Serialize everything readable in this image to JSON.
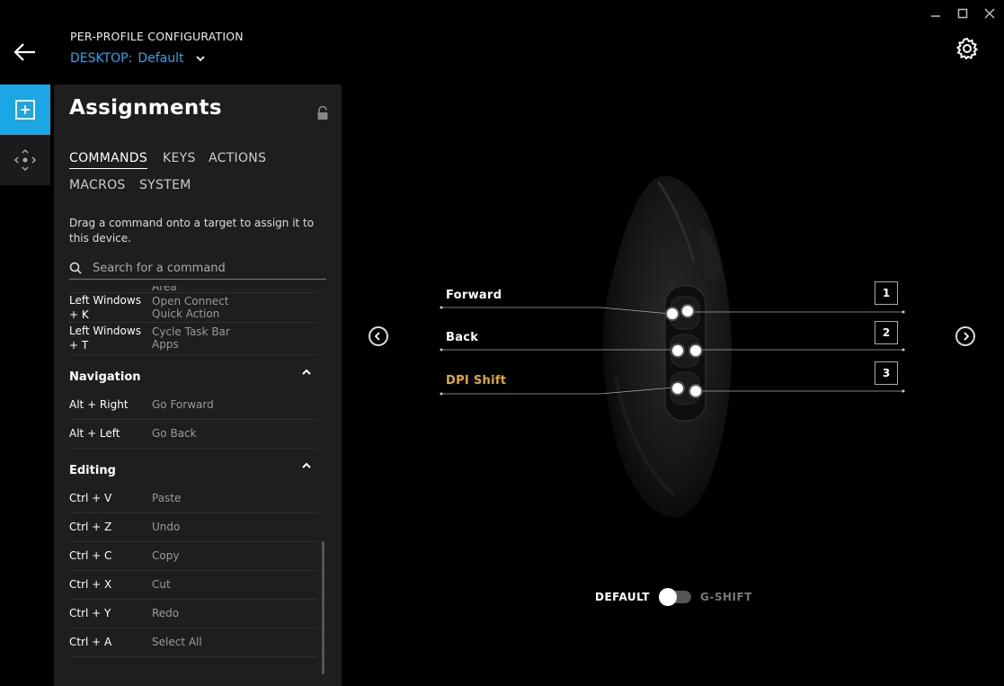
{
  "window": {
    "controls": [
      "minimize",
      "maximize",
      "close"
    ]
  },
  "header": {
    "title": "PER-PROFILE CONFIGURATION",
    "profile_label": "DESKTOP:",
    "profile_name": "Default"
  },
  "panel": {
    "title": "Assignments",
    "tabs": [
      {
        "label": "COMMANDS",
        "active": true
      },
      {
        "label": "KEYS"
      },
      {
        "label": "ACTIONS"
      },
      {
        "label": "MACROS"
      },
      {
        "label": "SYSTEM"
      }
    ],
    "help_text": "Drag a command onto a target to assign it to this device.",
    "search_placeholder": "Search for a command",
    "partial_top": "Area",
    "rows_top": [
      {
        "keys": "Left Windows + K",
        "command": "Open Connect Quick Action"
      },
      {
        "keys": "Left Windows + T",
        "command": "Cycle Task Bar Apps"
      }
    ],
    "sections": [
      {
        "title": "Navigation",
        "rows": [
          {
            "keys": "Alt + Right",
            "command": "Go Forward"
          },
          {
            "keys": "Alt + Left",
            "command": "Go Back"
          }
        ]
      },
      {
        "title": "Editing",
        "rows": [
          {
            "keys": "Ctrl + V",
            "command": "Paste"
          },
          {
            "keys": "Ctrl + Z",
            "command": "Undo"
          },
          {
            "keys": "Ctrl + C",
            "command": "Copy"
          },
          {
            "keys": "Ctrl + X",
            "command": "Cut"
          },
          {
            "keys": "Ctrl + Y",
            "command": "Redo"
          },
          {
            "keys": "Ctrl + A",
            "command": "Select All"
          }
        ]
      }
    ]
  },
  "device": {
    "buttons": [
      {
        "label": "Forward",
        "number": "1",
        "color": "#ffffff"
      },
      {
        "label": "Back",
        "number": "2",
        "color": "#ffffff"
      },
      {
        "label": "DPI Shift",
        "number": "3",
        "color": "#e0a93a"
      }
    ],
    "toggle": {
      "left": "DEFAULT",
      "right": "G-SHIFT"
    }
  },
  "colors": {
    "accent": "#1ba6e6",
    "dpi": "#e0a93a"
  }
}
